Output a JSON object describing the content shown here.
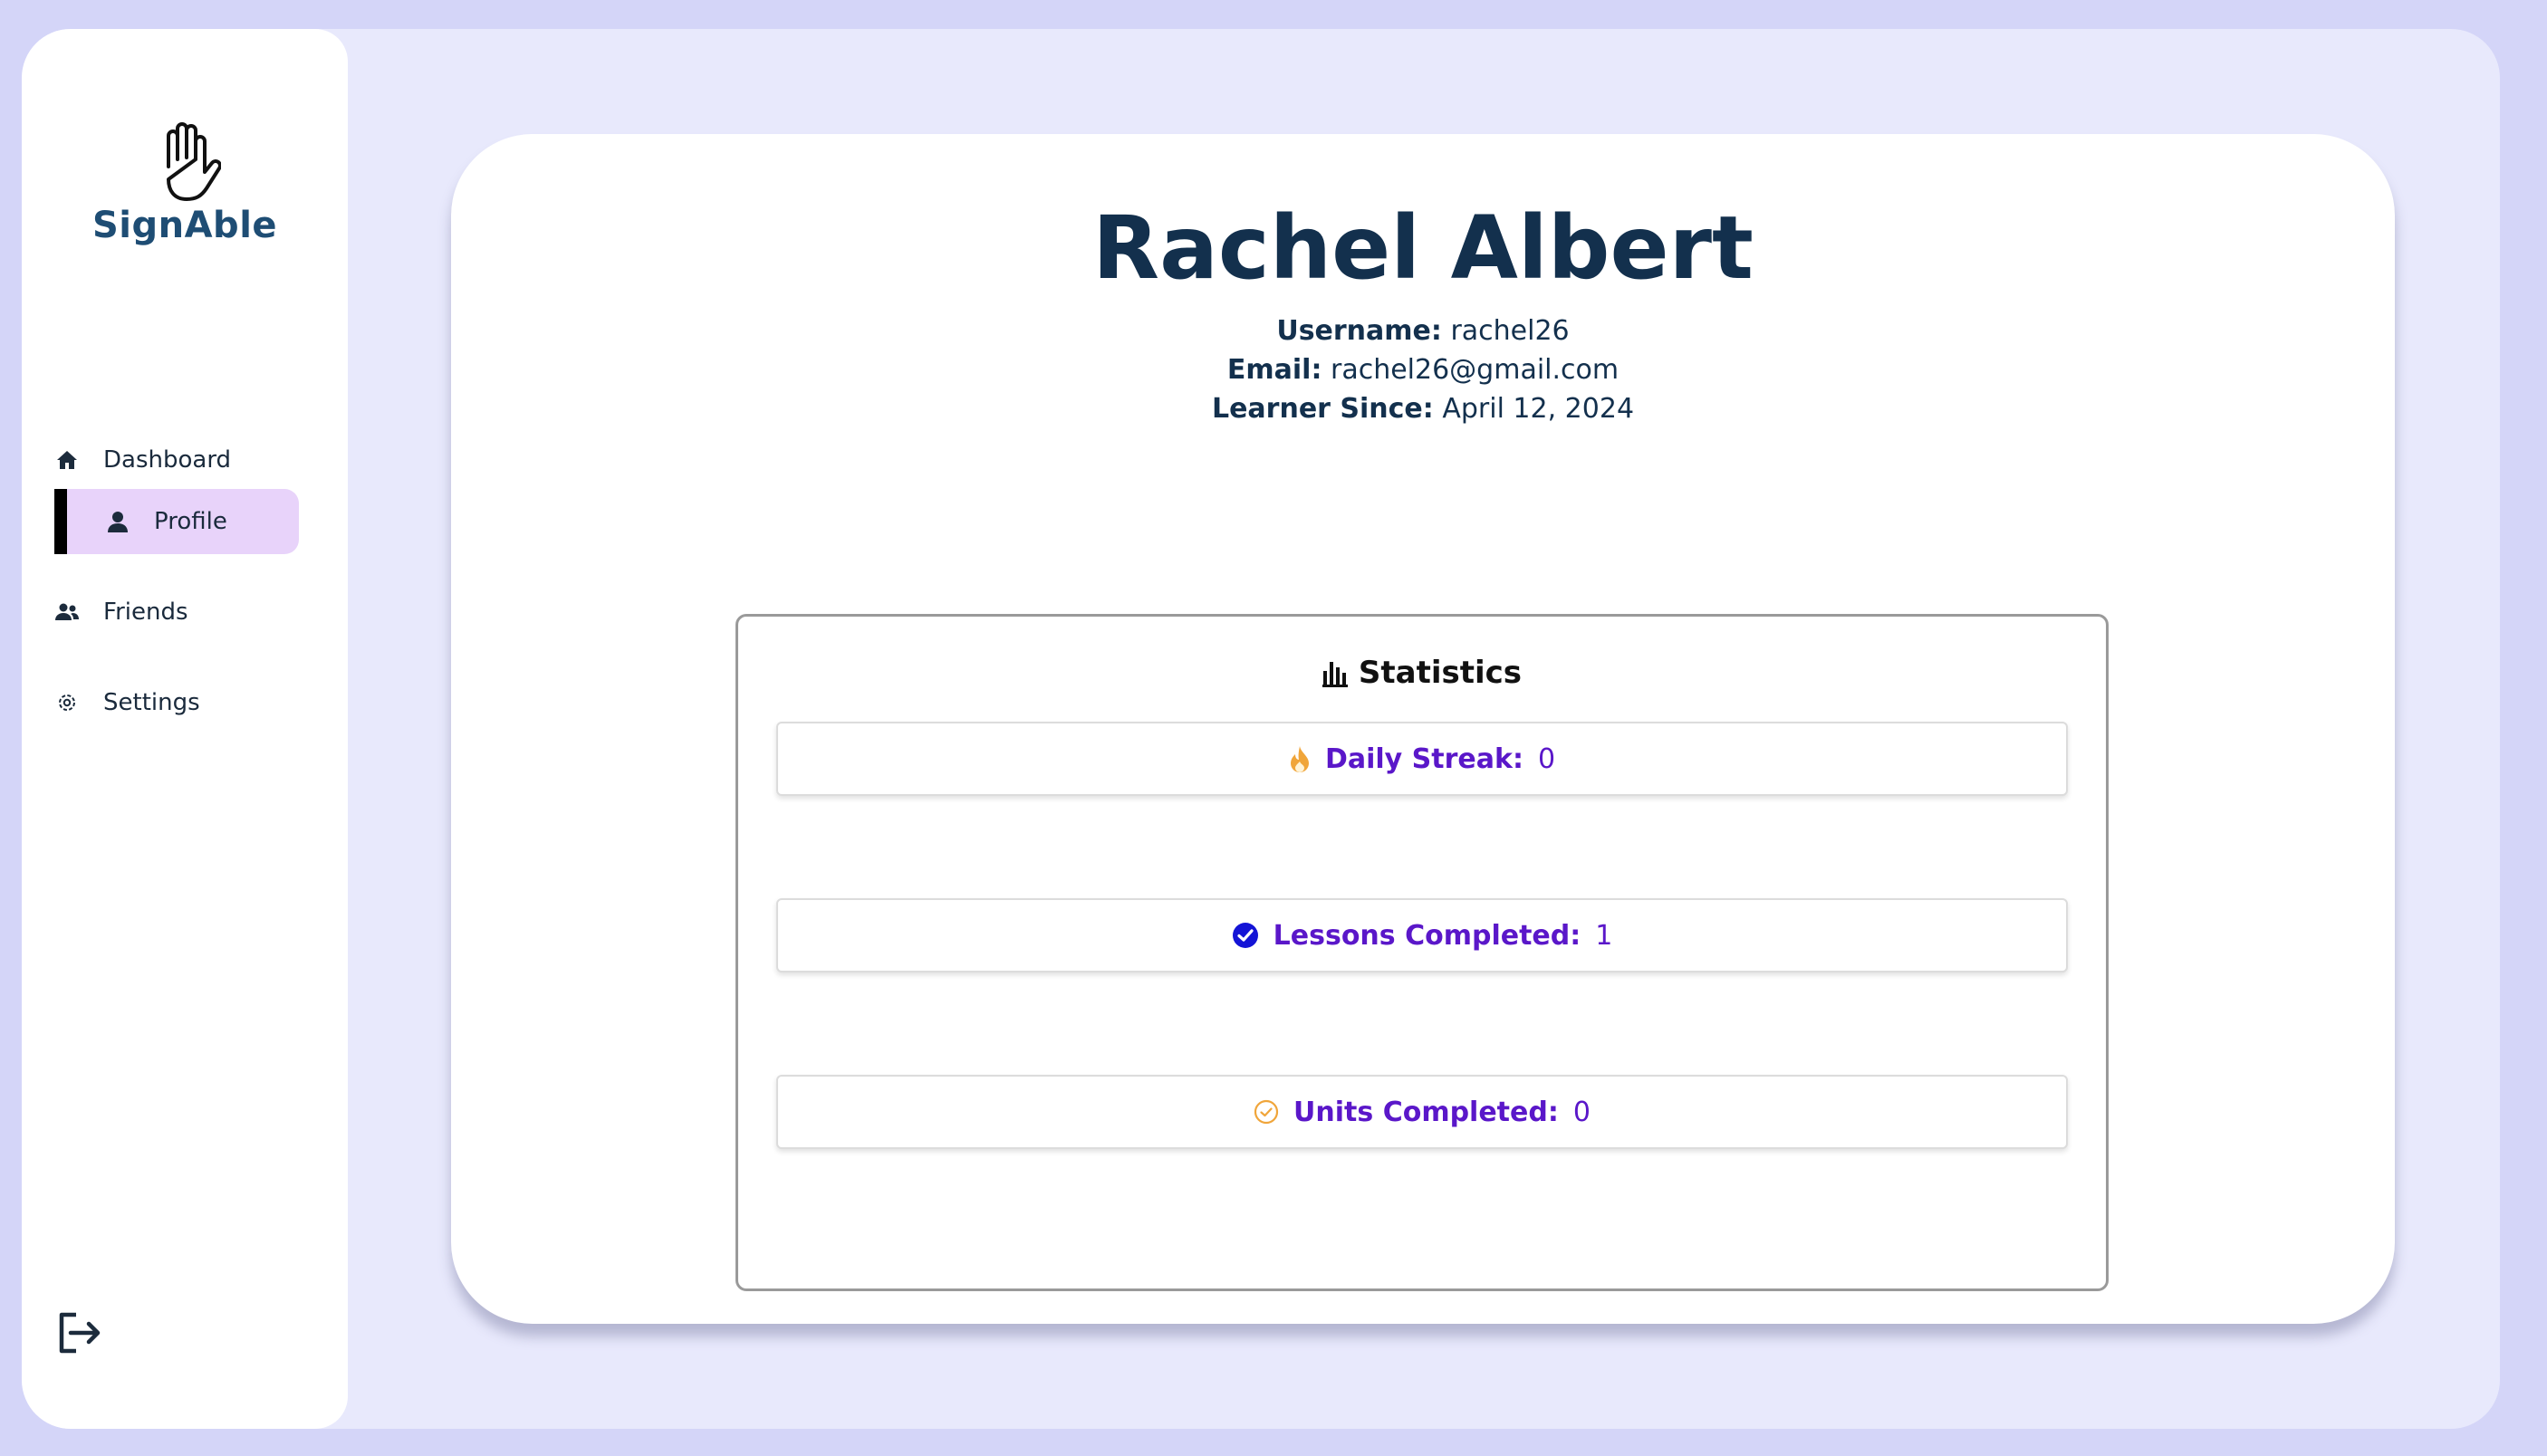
{
  "app": {
    "name": "SignAble"
  },
  "sidebar": {
    "items": [
      {
        "label": "Dashboard",
        "icon": "home-icon",
        "active": false
      },
      {
        "label": "Profile",
        "icon": "user-icon",
        "active": true
      },
      {
        "label": "Friends",
        "icon": "friends-icon",
        "active": false
      },
      {
        "label": "Settings",
        "icon": "gear-icon",
        "active": false
      }
    ],
    "logout_icon": "logout-icon"
  },
  "profile": {
    "name": "Rachel Albert",
    "username_label": "Username:",
    "username": "rachel26",
    "email_label": "Email:",
    "email": "rachel26@gmail.com",
    "since_label": "Learner Since:",
    "since": "April 12, 2024"
  },
  "statistics": {
    "title": "Statistics",
    "icon": "bar-chart-icon",
    "items": [
      {
        "label": "Daily Streak:",
        "value": "0",
        "icon": "flame-icon"
      },
      {
        "label": "Lessons Completed:",
        "value": "1",
        "icon": "check-circle-icon"
      },
      {
        "label": "Units Completed:",
        "value": "0",
        "icon": "check-circle-outline-icon"
      }
    ]
  },
  "colors": {
    "background": "#d4d5f8",
    "frame": "#e8e9fc",
    "active_nav": "#e8d3fa",
    "stat_text": "#5a17c9",
    "heading": "#13304d"
  }
}
